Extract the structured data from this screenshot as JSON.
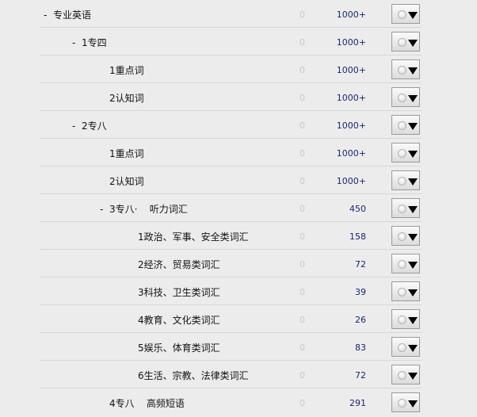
{
  "rows": [
    {
      "label": "专业英语",
      "toggle": "-",
      "zero": "0",
      "count": "1000+",
      "depth": 0
    },
    {
      "label": "1专四",
      "toggle": "-",
      "zero": "0",
      "count": "1000+",
      "depth": 1
    },
    {
      "label": "1重点词",
      "toggle": "",
      "zero": "0",
      "count": "1000+",
      "depth": 2
    },
    {
      "label": "2认知词",
      "toggle": "",
      "zero": "0",
      "count": "1000+",
      "depth": 2
    },
    {
      "label": "2专八",
      "toggle": "-",
      "zero": "0",
      "count": "1000+",
      "depth": 1
    },
    {
      "label": "1重点词",
      "toggle": "",
      "zero": "0",
      "count": "1000+",
      "depth": 2
    },
    {
      "label": "2认知词",
      "toggle": "",
      "zero": "0",
      "count": "1000+",
      "depth": 2
    },
    {
      "label": "3专八·    听力词汇",
      "toggle": "-",
      "zero": "0",
      "count": "450",
      "depth": 3
    },
    {
      "label": "1政治、军事、安全类词汇",
      "toggle": "",
      "zero": "0",
      "count": "158",
      "depth": 4
    },
    {
      "label": "2经济、贸易类词汇",
      "toggle": "",
      "zero": "0",
      "count": "72",
      "depth": 4
    },
    {
      "label": "3科技、卫生类词汇",
      "toggle": "",
      "zero": "0",
      "count": "39",
      "depth": 4
    },
    {
      "label": "4教育、文化类词汇",
      "toggle": "",
      "zero": "0",
      "count": "26",
      "depth": 4
    },
    {
      "label": "5娱乐、体育类词汇",
      "toggle": "",
      "zero": "0",
      "count": "83",
      "depth": 4
    },
    {
      "label": "6生活、宗教、法律类词汇",
      "toggle": "",
      "zero": "0",
      "count": "72",
      "depth": 4
    },
    {
      "label": "4专八    高频短语",
      "toggle": "",
      "zero": "0",
      "count": "291",
      "depth": 2
    }
  ],
  "row_action_icon": "dropdown-circle-arrow-icon",
  "colors": {
    "background": "#ececec",
    "count_text": "#1a2670",
    "zero_text": "#c8c8c8",
    "divider": "#d7d7d7"
  }
}
